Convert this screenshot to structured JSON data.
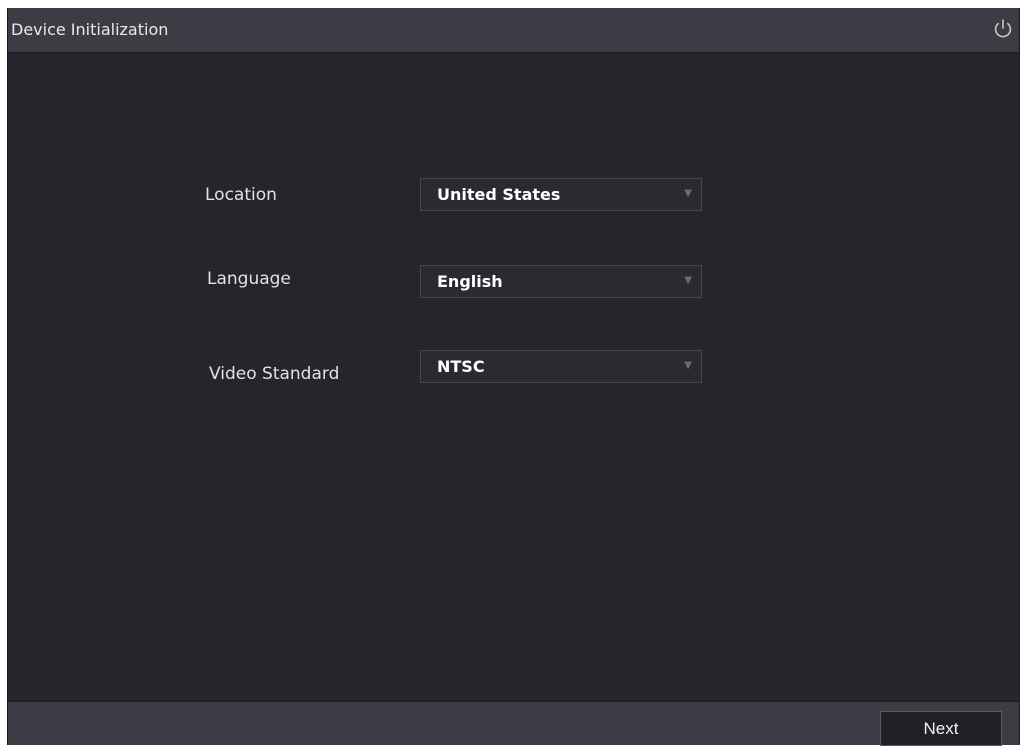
{
  "window": {
    "title": "Device Initialization",
    "power_icon": "power-icon"
  },
  "form": {
    "location": {
      "label": "Location",
      "value": "United States"
    },
    "language": {
      "label": "Language",
      "value": "English"
    },
    "video_standard": {
      "label": "Video Standard",
      "value": "NTSC"
    },
    "dropdown_icon": "dropdown-arrow-icon"
  },
  "footer": {
    "next_label": "Next"
  },
  "colors": {
    "background": "#25252c",
    "bar": "#3c3c45",
    "text": "#e2e2e2"
  }
}
